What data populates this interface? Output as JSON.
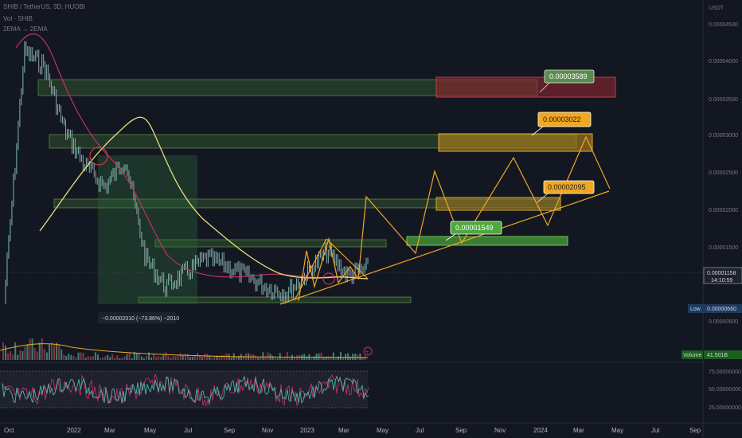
{
  "header": {
    "symbol_line": "SHIB / TetherUS, 3D, HUOBI",
    "vol_line": "Vol · SHIB",
    "ema_line": "2EMA → 2EMA",
    "currency": "USDT"
  },
  "price_axis": {
    "ticks": [
      "0.00004500",
      "0.00004000",
      "0.00003500",
      "0.00003000",
      "0.00002500",
      "0.00002000",
      "0.00001500",
      "0.00000500"
    ],
    "current_price": "0.00001158",
    "countdown": "14:10:59",
    "low_label": "Low",
    "low_value": "0.00000660",
    "volume_label": "Volume",
    "volume_value": "41.501B"
  },
  "rsi_axis": {
    "ticks": [
      "75.00000000",
      "50.00000000",
      "25.00000000"
    ]
  },
  "time_axis": {
    "labels": [
      "Oct",
      "2022",
      "Mar",
      "May",
      "Jul",
      "Sep",
      "Nov",
      "2023",
      "Mar",
      "May",
      "Jul",
      "Sep",
      "Nov",
      "2024",
      "Mar",
      "May",
      "Jul",
      "Sep"
    ]
  },
  "annotations": {
    "target_1": "0.00001549",
    "target_2": "0.00002095",
    "target_3": "0.00003022",
    "target_4": "0.00003589",
    "measure": "−0.00002010 (−73.86%) −2010"
  },
  "colors": {
    "background": "#131722",
    "candles": "#8fa3a8",
    "ema_long": "#e8e07a",
    "ema_short": "#c0306a",
    "projection": "#f0a822",
    "zone_green": "#4e8c3c",
    "zone_orange": "#c8901c",
    "zone_red": "#9a2630"
  },
  "chart_data": {
    "type": "line",
    "title": "SHIB / TetherUS, 3D, HUOBI",
    "ylabel": "USDT",
    "xlabel": "",
    "ylim": [
      4e-06,
      4.9e-05
    ],
    "x": [
      "2021-10",
      "2021-11",
      "2021-12",
      "2022-01",
      "2022-02",
      "2022-03",
      "2022-04",
      "2022-05",
      "2022-06",
      "2022-07",
      "2022-08",
      "2022-09",
      "2022-10",
      "2022-11",
      "2022-12",
      "2023-01",
      "2023-02",
      "2023-03",
      "2023-04"
    ],
    "series": [
      {
        "name": "SHIB",
        "values": [
          7e-06,
          4.2e-05,
          4e-05,
          3.1e-05,
          2.6e-05,
          2.3e-05,
          2.7e-05,
          1.3e-05,
          9e-06,
          1.1e-05,
          1.3e-05,
          1.2e-05,
          1.05e-05,
          9e-06,
          8.2e-06,
          1.1e-05,
          1.4e-05,
          1.06e-05,
          1.16e-05
        ]
      }
    ],
    "projection_targets": [
      1.549e-05,
      2.095e-05,
      3.022e-05,
      3.589e-05
    ],
    "drop_measure_percent": -73.86
  }
}
